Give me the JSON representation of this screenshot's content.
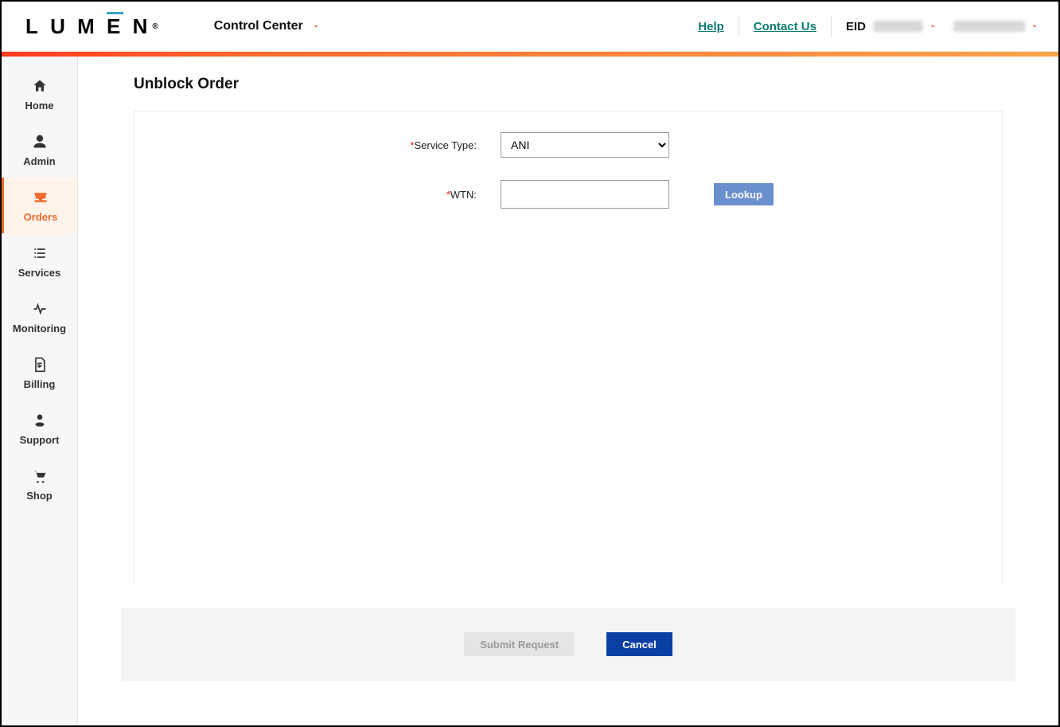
{
  "header": {
    "logo_text": "LUM   N",
    "logo_e": "E",
    "app_dropdown": "Control Center",
    "help": "Help",
    "contact": "Contact Us",
    "eid_label": "EID"
  },
  "sidebar": {
    "items": [
      {
        "label": "Home"
      },
      {
        "label": "Admin"
      },
      {
        "label": "Orders"
      },
      {
        "label": "Services"
      },
      {
        "label": "Monitoring"
      },
      {
        "label": "Billing"
      },
      {
        "label": "Support"
      },
      {
        "label": "Shop"
      }
    ]
  },
  "page_title": "Unblock Order",
  "form": {
    "service_type_label": "Service Type:",
    "service_type_value": "ANI",
    "wtn_label": "WTN:",
    "wtn_value": "",
    "lookup": "Lookup"
  },
  "footer": {
    "submit": "Submit Request",
    "cancel": "Cancel"
  }
}
